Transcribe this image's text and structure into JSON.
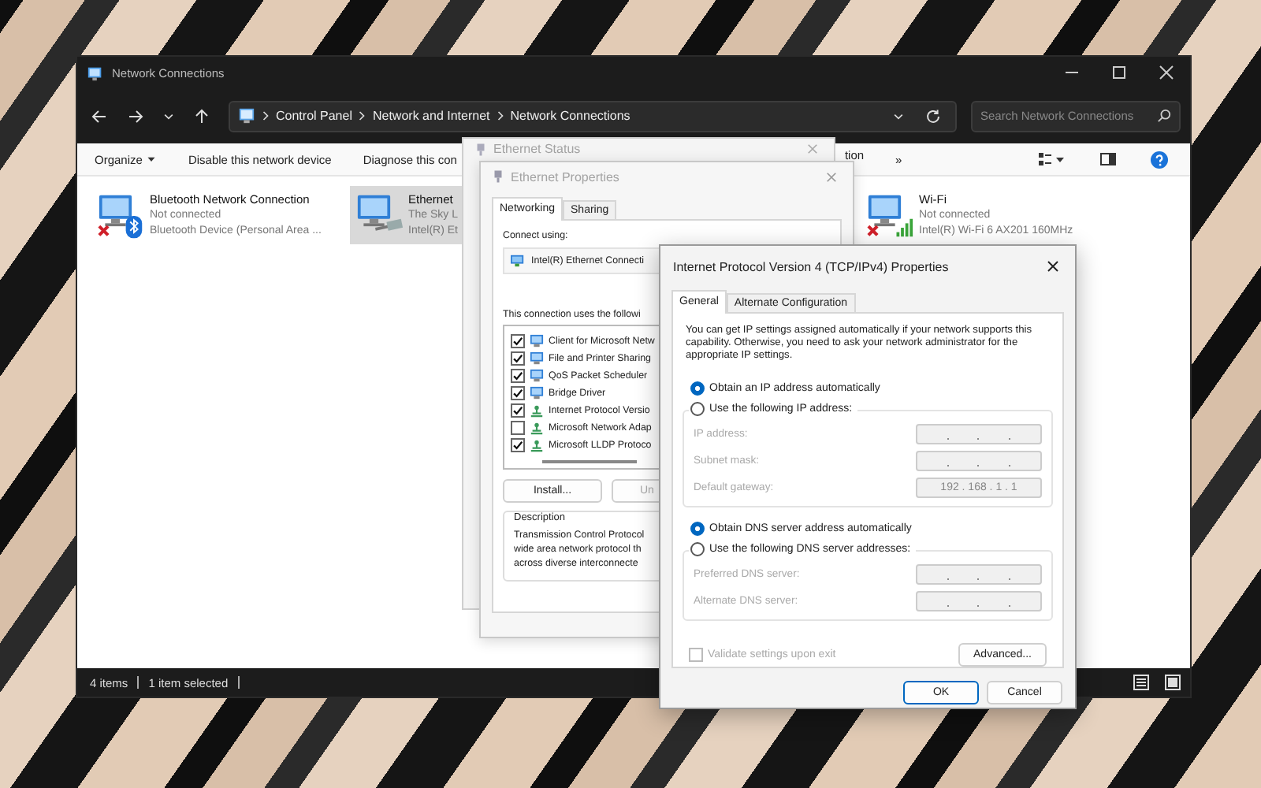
{
  "explorer": {
    "title": "Network Connections",
    "address": {
      "crumbs": [
        "Control Panel",
        "Network and Internet",
        "Network Connections"
      ]
    },
    "search": {
      "placeholder": "Search Network Connections"
    },
    "commands": [
      {
        "label": "Organize",
        "kind": "menu"
      },
      {
        "label": "Disable this network device",
        "kind": "command"
      },
      {
        "label": "Diagnose this con",
        "kind": "command"
      },
      {
        "label": "tion",
        "kind": "tail"
      },
      {
        "label": "»",
        "kind": "overflow"
      }
    ],
    "connections": [
      {
        "name": "Bluetooth Network Connection",
        "status": "Not connected",
        "device": "Bluetooth Device (Personal Area ...",
        "kind": "bluetooth",
        "connected": false,
        "selected": false
      },
      {
        "name": "Ethernet",
        "status": "The Sky L",
        "device": "Intel(R) Et",
        "kind": "ethernet",
        "connected": true,
        "selected": true
      },
      {
        "name": "Wi-Fi",
        "status": "Not connected",
        "device": "Intel(R) Wi-Fi 6 AX201 160MHz",
        "kind": "wifi",
        "connected": false,
        "selected": false
      }
    ],
    "status_bar": [
      "4 items",
      "1 item selected"
    ]
  },
  "status_dialog": {
    "title": "Ethernet Status"
  },
  "properties": {
    "title": "Ethernet Properties",
    "tabs": [
      {
        "label": "Networking",
        "selected": true
      },
      {
        "label": "Sharing",
        "selected": false
      }
    ],
    "connect_using_label": "Connect using:",
    "adapter": "Intel(R) Ethernet Connecti",
    "items_label": "This connection uses the followi",
    "items": [
      {
        "label": "Client for Microsoft Netw",
        "checked": true,
        "kind": "client"
      },
      {
        "label": "File and Printer Sharing",
        "checked": true,
        "kind": "client"
      },
      {
        "label": "QoS Packet Scheduler",
        "checked": true,
        "kind": "client"
      },
      {
        "label": "Bridge Driver",
        "checked": true,
        "kind": "client"
      },
      {
        "label": "Internet Protocol Versio",
        "checked": true,
        "kind": "protocol"
      },
      {
        "label": "Microsoft Network Adap",
        "checked": false,
        "kind": "protocol"
      },
      {
        "label": "Microsoft LLDP Protoco",
        "checked": true,
        "kind": "protocol"
      }
    ],
    "buttons": [
      {
        "label": "Install...",
        "disabled": false
      },
      {
        "label": "Un",
        "disabled": true
      }
    ],
    "description": {
      "title": "Description",
      "text": "Transmission Control Protocol\nwide area network protocol th\nacross diverse interconnecte"
    }
  },
  "ipv4": {
    "title": "Internet Protocol Version 4 (TCP/IPv4) Properties",
    "tabs": [
      {
        "label": "General",
        "selected": true
      },
      {
        "label": "Alternate Configuration",
        "selected": false
      }
    ],
    "intro": "You can get IP settings assigned automatically if your network supports this capability. Otherwise, you need to ask your network administrator for the appropriate IP settings.",
    "ip_mode": [
      {
        "label": "Obtain an IP address automatically",
        "selected": true
      },
      {
        "label": "Use the following IP address:",
        "selected": false
      }
    ],
    "ip_fields": [
      {
        "label": "IP address:"
      },
      {
        "label": "Subnet mask:"
      },
      {
        "label": "Default gateway:",
        "value": "192 . 168 . 1 . 1"
      }
    ],
    "dns_mode": [
      {
        "label": "Obtain DNS server address automatically",
        "selected": true
      },
      {
        "label": "Use the following DNS server addresses:",
        "selected": false
      }
    ],
    "dns_fields": [
      {
        "label": "Preferred DNS server:"
      },
      {
        "label": "Alternate DNS server:"
      }
    ],
    "validate": {
      "label": "Validate settings upon exit",
      "checked": false,
      "disabled": true
    },
    "advanced": "Advanced...",
    "buttons": [
      {
        "label": "OK",
        "kind": "default"
      },
      {
        "label": "Cancel",
        "kind": "normal"
      }
    ]
  }
}
